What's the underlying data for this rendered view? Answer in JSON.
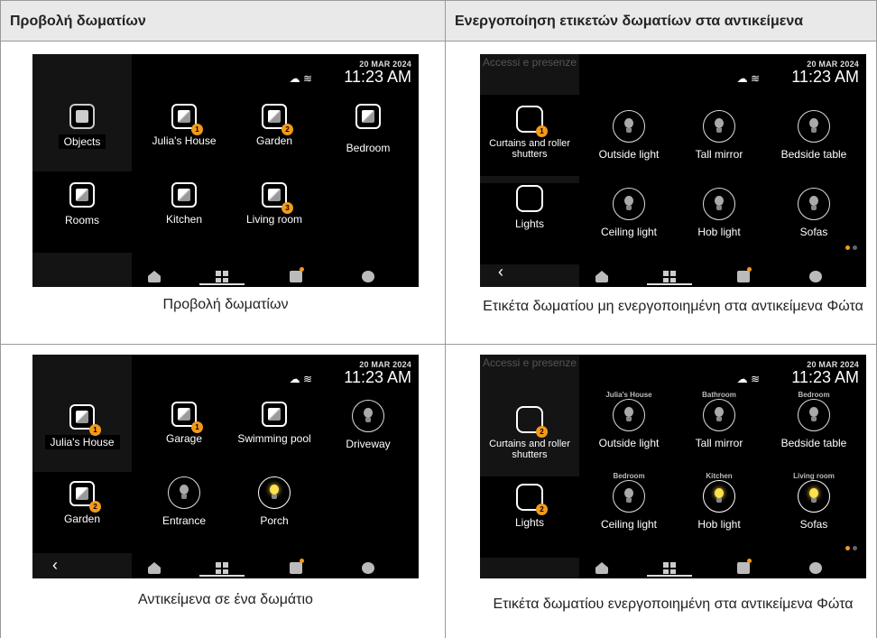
{
  "headers": {
    "left": "Προβολή δωματίων",
    "right": "Ενεργοποίηση ετικετών δωματίων στα αντικείμενα"
  },
  "status": {
    "date": "20 MAR 2024",
    "time": "11:23 AM"
  },
  "screen1": {
    "sidebar": [
      "Objects",
      "Rooms"
    ],
    "tiles": [
      {
        "label": "Julia's House",
        "badge": "1"
      },
      {
        "label": "Garden",
        "badge": "2"
      },
      {
        "label": "Bedroom",
        "badge": ""
      },
      {
        "label": "Kitchen",
        "badge": ""
      },
      {
        "label": "Living room",
        "badge": "3"
      }
    ],
    "caption": "Προβολή δωματίων"
  },
  "screen2": {
    "sidebar_faded": "Accessi e presenze",
    "sidebar": [
      {
        "label": "Curtains and roller shutters",
        "badge": "1"
      },
      {
        "label": "Lights",
        "badge": ""
      }
    ],
    "tiles": [
      "Outside light",
      "Tall mirror",
      "Bedside table",
      "Ceiling light",
      "Hob light",
      "Sofas"
    ],
    "caption": "Ετικέτα δωματίου μη ενεργοποιημένη στα αντικείμενα Φώτα"
  },
  "screen3": {
    "sidebar": [
      {
        "label": "Julia's House",
        "badge": "1"
      },
      {
        "label": "Garden",
        "badge": "2"
      }
    ],
    "tiles": [
      {
        "label": "Garage",
        "badge": "1"
      },
      {
        "label": "Swimming pool",
        "badge": ""
      },
      {
        "label": "Driveway",
        "badge": ""
      },
      {
        "label": "Entrance",
        "badge": ""
      },
      {
        "label": "Porch",
        "badge": ""
      }
    ],
    "caption": "Αντικείμενα σε ένα δωμάτιο"
  },
  "screen4": {
    "sidebar_faded": "Accessi e presenze",
    "sidebar": [
      {
        "label": "Curtains and roller shutters",
        "badge": "2"
      },
      {
        "label": "Lights",
        "badge": "2"
      }
    ],
    "rooms": [
      "Julia's House",
      "Bathroom",
      "Bedroom",
      "Bedroom",
      "Kitchen",
      "Living room"
    ],
    "tiles": [
      "Outside light",
      "Tall mirror",
      "Bedside table",
      "Ceiling light",
      "Hob light",
      "Sofas"
    ],
    "caption": "Ετικέτα δωματίου ενεργοποιημένη στα αντικείμενα Φώτα"
  },
  "colors": {
    "accent": "#f29a1b",
    "bulb_on": "#ffe14a"
  }
}
